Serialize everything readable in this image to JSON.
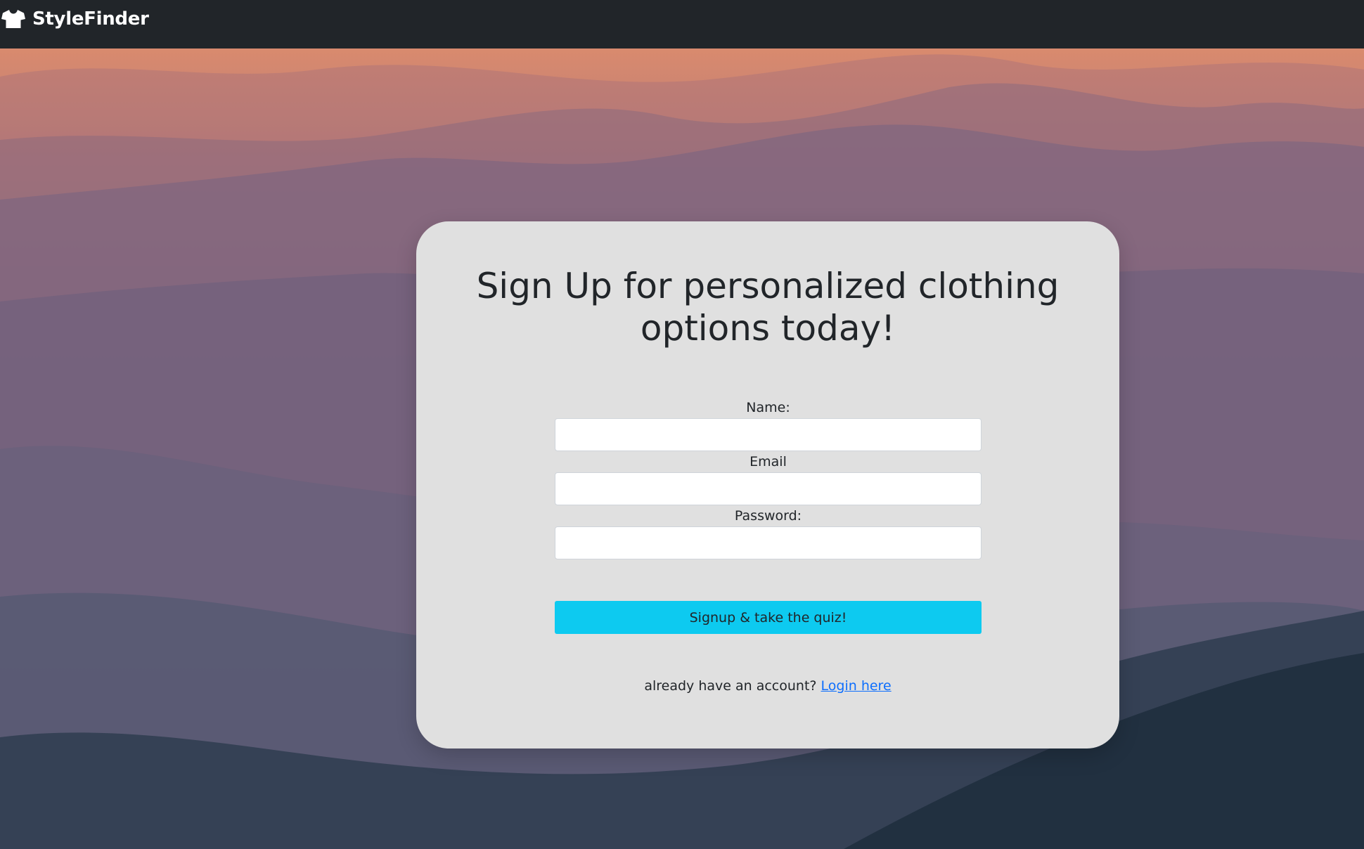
{
  "navbar": {
    "brand_name": "StyleFinder",
    "brand_icon": "tshirt-icon"
  },
  "signup": {
    "title": "Sign Up for personalized clothing options today!",
    "name_label": "Name:",
    "name_value": "",
    "email_label": "Email",
    "email_value": "",
    "password_label": "Password:",
    "password_value": "",
    "submit_label": "Signup & take the quiz!",
    "login_prompt": "already have an account?",
    "login_link": "Login here"
  },
  "colors": {
    "navbar_bg": "#212529",
    "card_bg": "#e0e0e0",
    "button_bg": "#0dcaf0",
    "link": "#0d6efd"
  }
}
